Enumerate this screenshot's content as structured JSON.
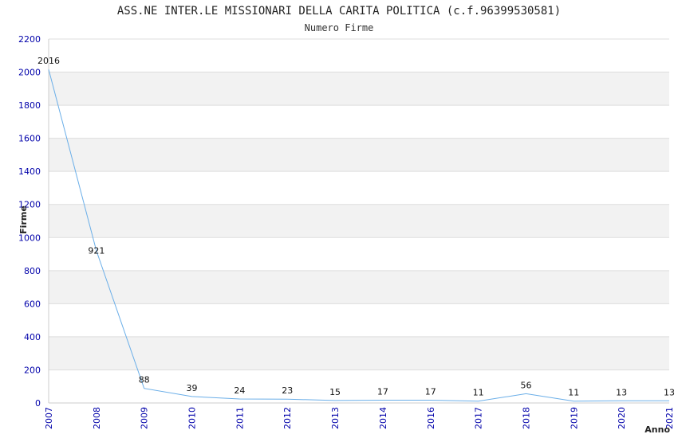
{
  "chart_data": {
    "type": "line",
    "title": "ASS.NE INTER.LE MISSIONARI DELLA CARITA POLITICA (c.f.96399530581)",
    "subtitle": "Numero Firme",
    "xlabel": "Anno",
    "ylabel": "Firme",
    "ylim": [
      0,
      2200
    ],
    "yticks": [
      0,
      200,
      400,
      600,
      800,
      1000,
      1200,
      1400,
      1600,
      1800,
      2000,
      2200
    ],
    "categories": [
      "2007",
      "2008",
      "2009",
      "2010",
      "2011",
      "2012",
      "2013",
      "2014",
      "2016",
      "2017",
      "2018",
      "2019",
      "2020",
      "2021"
    ],
    "series": [
      {
        "values": [
          2016,
          921,
          88,
          39,
          24,
          23,
          15,
          17,
          17,
          11,
          56,
          11,
          13,
          13
        ]
      }
    ],
    "grid": true,
    "colors": {
      "line": "#6aaee8",
      "tick_label": "#0000aa",
      "band": "#f2f2f2",
      "grid": "#dddddd"
    }
  }
}
